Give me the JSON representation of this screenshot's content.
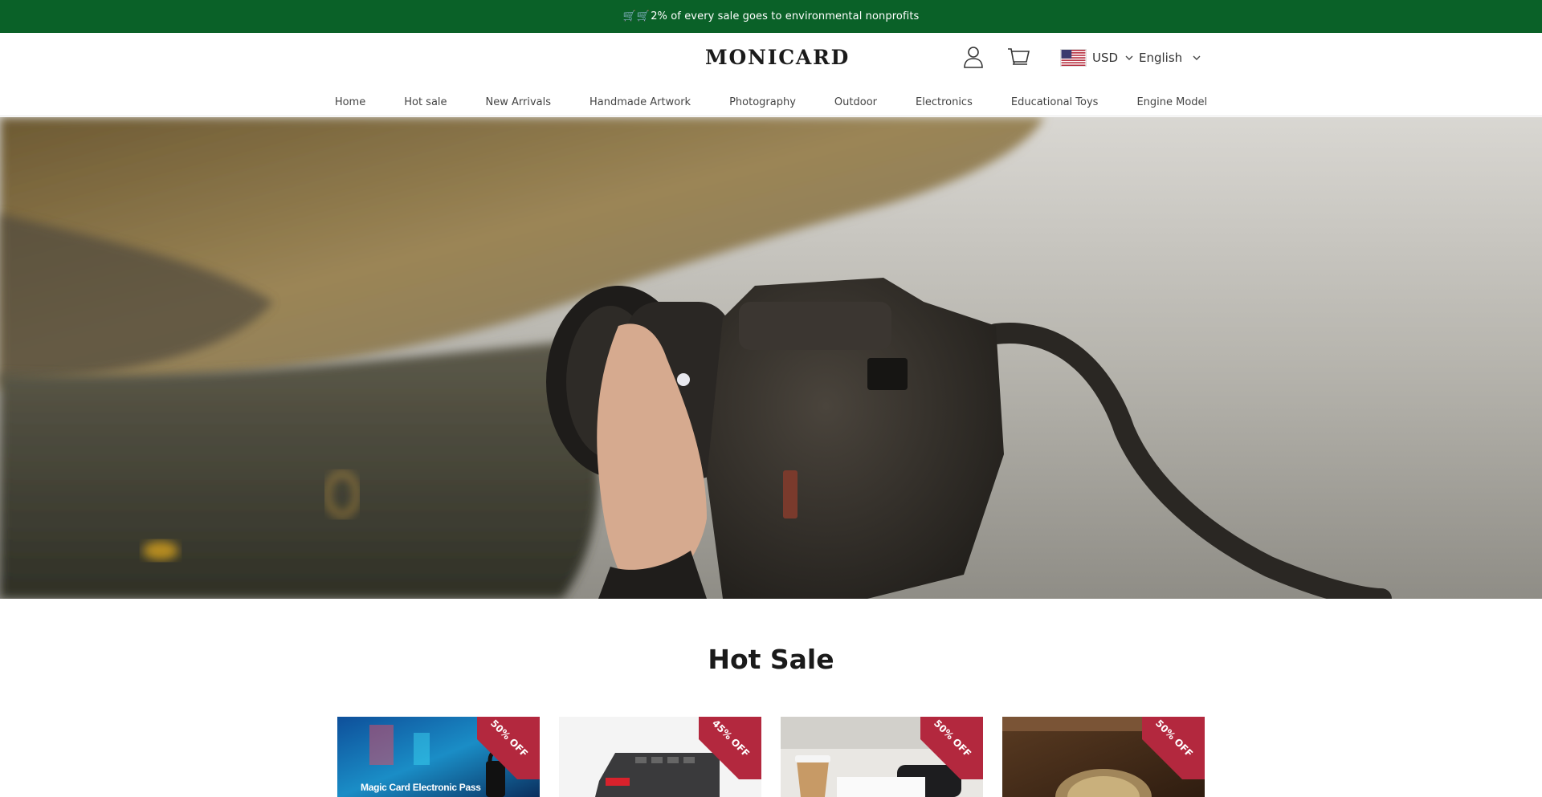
{
  "announcement": {
    "text": "2% of every sale goes to environmental nonprofits",
    "icons": [
      "shopping-cart-emoji",
      "shopping-cart-emoji"
    ]
  },
  "header": {
    "logo": "MONICARD",
    "icons": [
      "account-icon",
      "cart-icon"
    ],
    "currency": {
      "flag": "us-flag-icon",
      "label": "USD"
    },
    "language": {
      "label": "English"
    }
  },
  "nav": {
    "items": [
      {
        "label": "Home"
      },
      {
        "label": "Hot sale"
      },
      {
        "label": "New Arrivals"
      },
      {
        "label": "Handmade Artwork"
      },
      {
        "label": "Photography"
      },
      {
        "label": "Outdoor"
      },
      {
        "label": "Electronics"
      },
      {
        "label": "Educational Toys"
      },
      {
        "label": "Engine Model"
      }
    ]
  },
  "hot_sale": {
    "title": "Hot Sale",
    "products": [
      {
        "badge": "50% OFF",
        "caption": "Magic Card Electronic Pass"
      },
      {
        "badge": "45% OFF"
      },
      {
        "badge": "50% OFF"
      },
      {
        "badge": "50% OFF"
      }
    ]
  },
  "colors": {
    "announcement_bg": "#0a6128",
    "badge_bg": "#b3283e"
  }
}
